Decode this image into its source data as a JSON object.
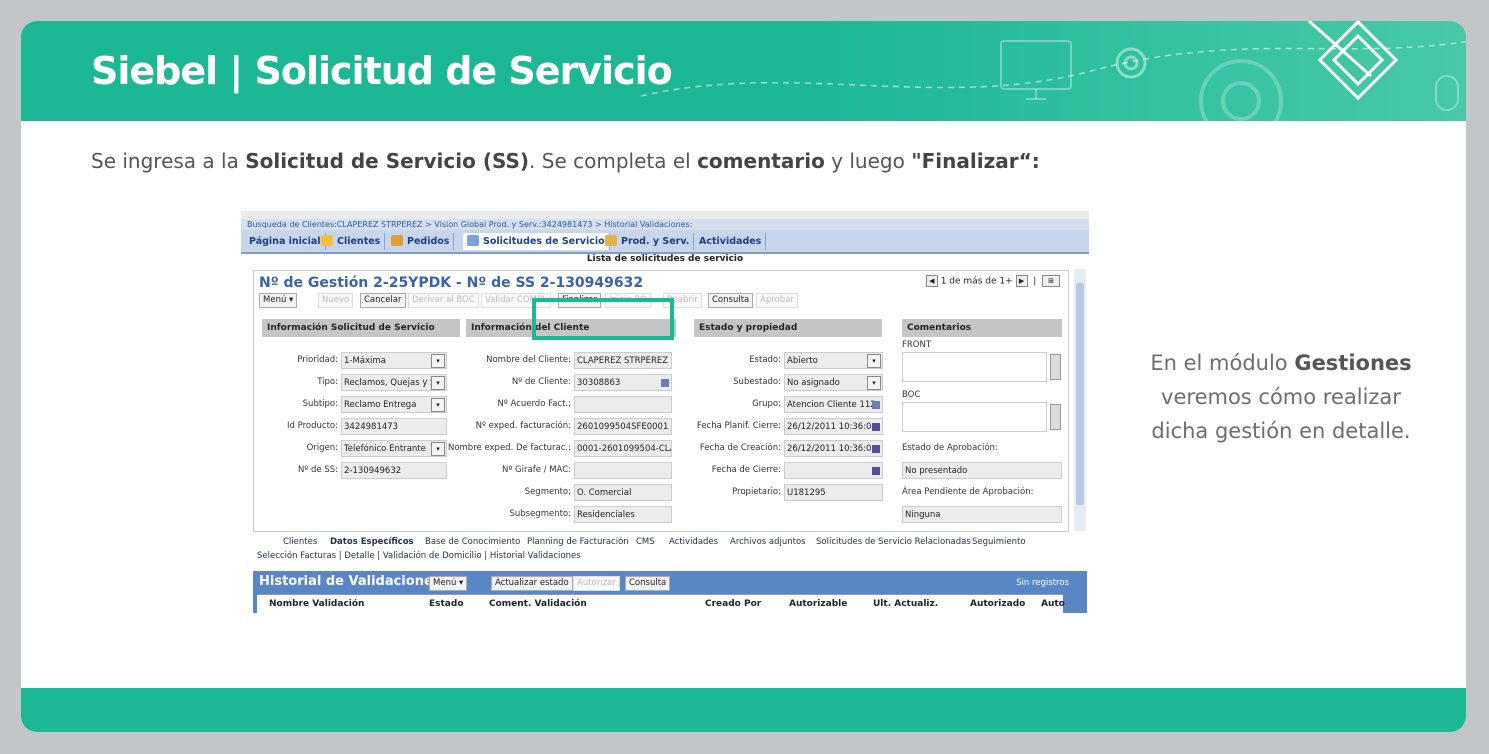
{
  "header": {
    "title": "Siebel | Solicitud de Servicio"
  },
  "intro": {
    "p1": "Se ingresa a la ",
    "b1": "Solicitud de Servicio (SS)",
    "p2": ". Se completa el ",
    "b2": "comentario",
    "p3": " y luego ",
    "b3": "\"Finalizar“:"
  },
  "side": {
    "p1": "En el módulo ",
    "b1": "Gestiones",
    "p2": "veremos cómo realizar",
    "p3": "dicha gestión en detalle."
  },
  "crumbs": "Busqueda de Clientes:CLAPEREZ STRPEREZ  > Vision Global Prod. y Serv.:3424981473  > Historial Validaciones:",
  "tabs": [
    "Página inicial",
    "Clientes",
    "Pedidos",
    "Solicitudes de Servicio",
    "Prod. y Serv.",
    "Actividades"
  ],
  "list_title": "Lista de solicitudes de servicio",
  "panel": {
    "title": "Nº de Gestión 2-25YPDK - Nº de SS 2-130949632",
    "pager": "1 de más de 1+",
    "buttons": [
      "Menú ▾",
      "Nuevo",
      "Cancelar",
      "Derivar al BOC",
      "Validar COMPL",
      "Finalizar",
      "Inicio BO",
      "Reabrir",
      "Consulta",
      "Aprobar"
    ]
  },
  "sections": {
    "s1": "Información Solicitud de Servicio",
    "s2": "Información del Cliente",
    "s3": "Estado y propiedad",
    "s4": "Comentarios"
  },
  "fields1": [
    {
      "label": "Prioridad:",
      "value": "1-Máxima"
    },
    {
      "label": "Tipo:",
      "value": "Reclamos, Quejas y S"
    },
    {
      "label": "Subtipo:",
      "value": "Reclamo Entrega"
    },
    {
      "label": "Id Producto:",
      "value": "3424981473"
    },
    {
      "label": "Origen:",
      "value": "Telefónico Entrante"
    },
    {
      "label": "Nº de SS:",
      "value": "2-130949632"
    }
  ],
  "fields2": [
    {
      "label": "Nombre del Cliente:",
      "value": "CLAPEREZ STRPEREZ"
    },
    {
      "label": "Nº de Cliente:",
      "value": "30308863"
    },
    {
      "label": "Nº Acuerdo Fact.:",
      "value": ""
    },
    {
      "label": "Nº exped. facturación:",
      "value": "2601099504SFE0001"
    },
    {
      "label": "Nombre exped. De facturac.:",
      "value": "0001-2601099504-CLAI"
    },
    {
      "label": "Nº Girafe / MAC:",
      "value": ""
    },
    {
      "label": "Segmento:",
      "value": "O. Comercial"
    },
    {
      "label": "Subsegmento:",
      "value": "Residenciales"
    }
  ],
  "fields3": [
    {
      "label": "Estado:",
      "value": "Abierto"
    },
    {
      "label": "Subestado:",
      "value": "No asignado"
    },
    {
      "label": "Grupo:",
      "value": "Atencion Cliente 112"
    },
    {
      "label": "Fecha Planif. Cierre:",
      "value": "26/12/2011 10:36:0"
    },
    {
      "label": "Fecha de Creación:",
      "value": "26/12/2011 10:36:0"
    },
    {
      "label": "Fecha de Cierre:",
      "value": ""
    },
    {
      "label": "Propietario:",
      "value": "U181295"
    }
  ],
  "comments": {
    "front": "FRONT",
    "boc": "BOC",
    "aprob_label": "Estado de Aprobación:",
    "aprob_value": "No presentado",
    "area_label": "Área Pendiente de Aprobación:",
    "area_value": "Ninguna"
  },
  "subtabs": [
    "Clientes",
    "Datos Específicos",
    "Base de Conocimiento",
    "Planning de Facturación",
    "CMS",
    "Actividades",
    "Archivos adjuntos",
    "Solicitudes de Servicio Relacionadas",
    "Seguimiento"
  ],
  "subtabs2": "Selección Facturas  |  Detalle  |  Validación de Domicilio  |  Historial Validaciones",
  "historial": {
    "title": "Historial de Validaciones",
    "menu": "Menú ▾",
    "btn1": "Actualizar estado",
    "btn2": "Autorizar",
    "btn3": "Consulta",
    "norec": "Sin registros",
    "cols": [
      "Nombre Validación",
      "Estado",
      "Coment. Validación",
      "Creado Por",
      "Autorizable",
      "Ult. Actualiz.",
      "Autorizado",
      "Auto"
    ]
  }
}
